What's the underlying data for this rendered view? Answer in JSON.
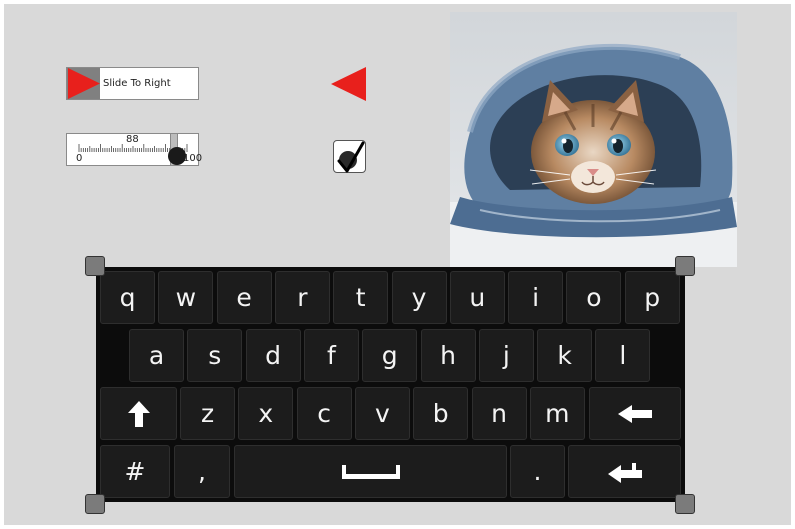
{
  "slider": {
    "label": "Slide To Right",
    "arrow_color": "#e8201c",
    "handle_icon": "play-triangle-icon"
  },
  "ruler": {
    "value": "88",
    "min_label": "0",
    "max_label": "100",
    "value_fraction": 0.88
  },
  "back_arrow": {
    "icon": "left-triangle-icon",
    "color": "#e8201c"
  },
  "checkbox": {
    "checked": true,
    "icon": "checkmark-icon"
  },
  "photo": {
    "subject": "kitten in denim"
  },
  "keyboard": {
    "row1": [
      "q",
      "w",
      "e",
      "r",
      "t",
      "y",
      "u",
      "i",
      "o",
      "p"
    ],
    "row2": [
      "a",
      "s",
      "d",
      "f",
      "g",
      "h",
      "j",
      "k",
      "l"
    ],
    "row3": [
      "z",
      "x",
      "c",
      "v",
      "b",
      "n",
      "m"
    ],
    "shift_icon": "shift-arrow-icon",
    "backspace_icon": "backspace-icon",
    "hash_label": "#",
    "comma_label": ",",
    "space_icon": "space-bar-icon",
    "period_label": ".",
    "enter_icon": "enter-icon"
  }
}
